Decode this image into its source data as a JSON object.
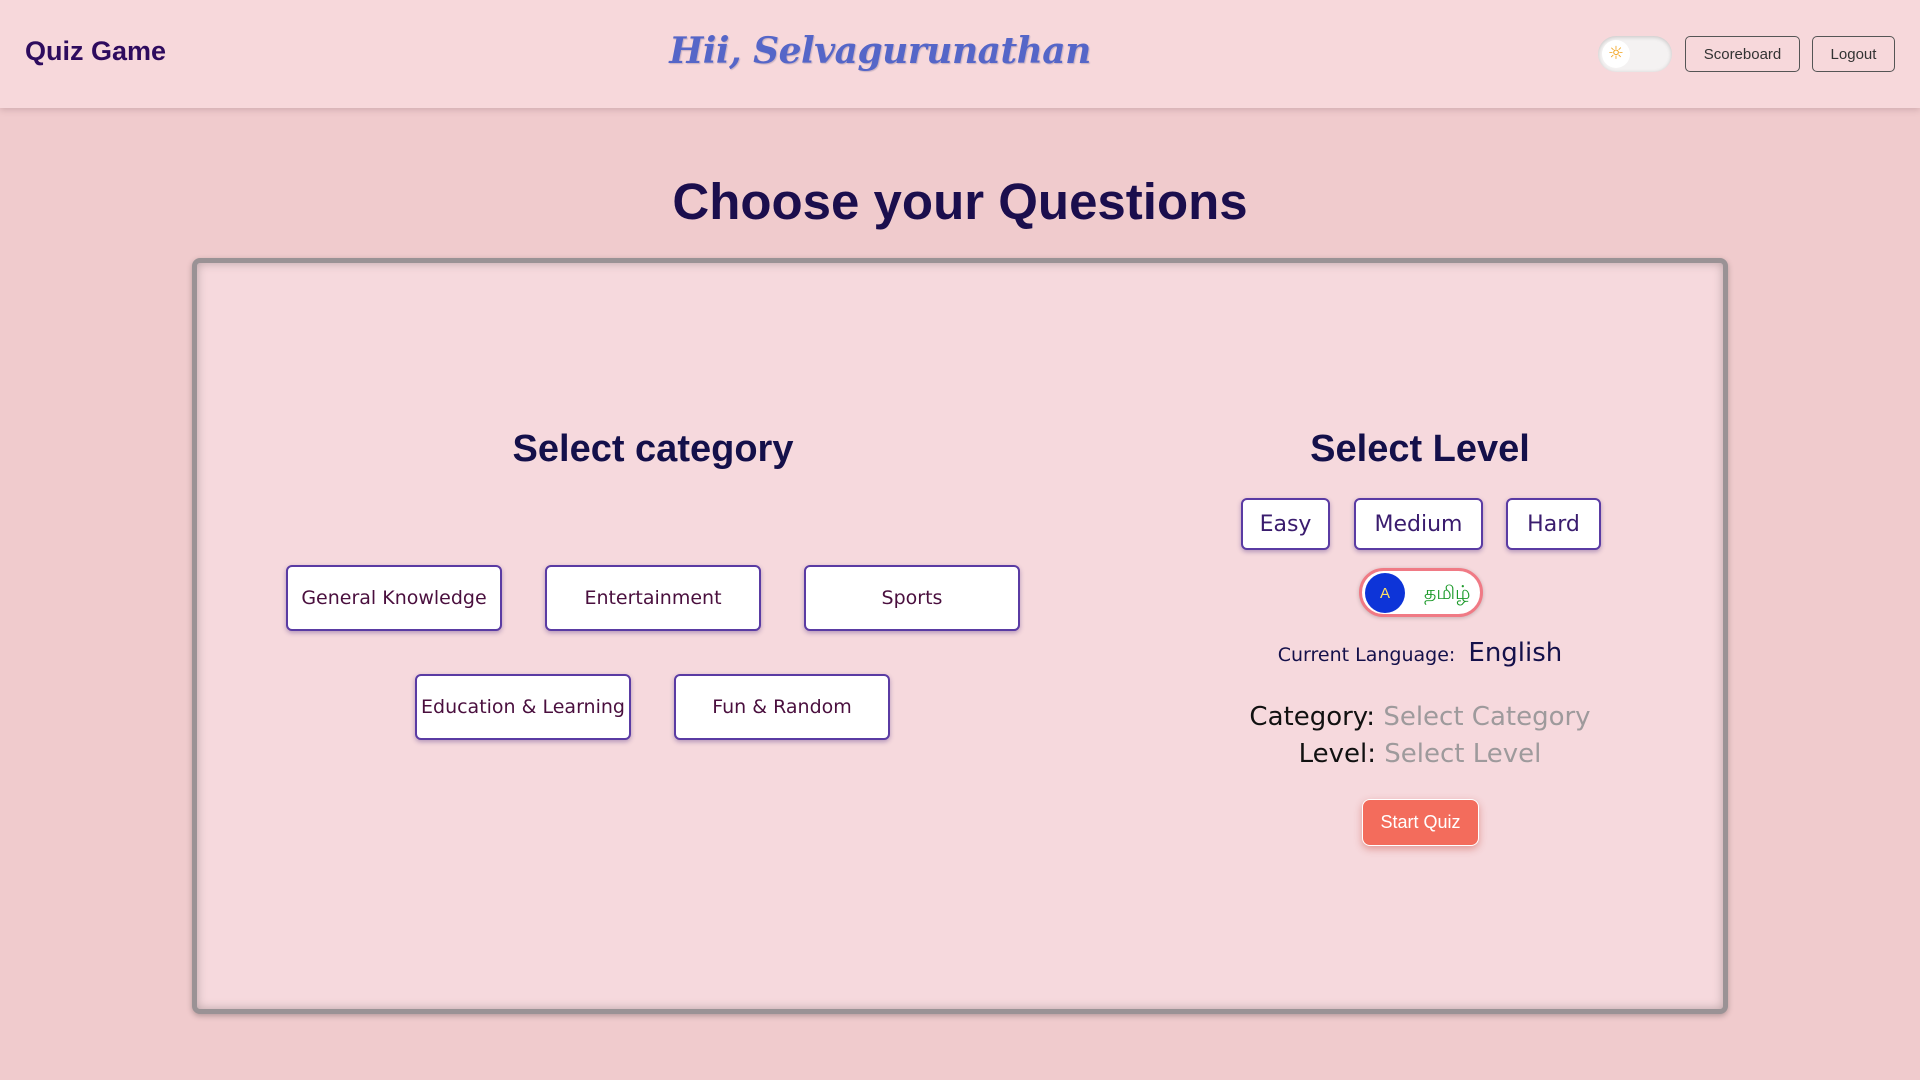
{
  "header": {
    "brand": "Quiz Game",
    "greeting": "Hii, Selvagurunathan",
    "theme_icon": "sun-icon",
    "scoreboard_label": "Scoreboard",
    "logout_label": "Logout"
  },
  "page_title": "Choose your Questions",
  "category": {
    "title": "Select category",
    "options": [
      "General Knowledge",
      "Entertainment",
      "Sports",
      "Education & Learning",
      "Fun & Random"
    ]
  },
  "level": {
    "title": "Select Level",
    "options": [
      "Easy",
      "Medium",
      "Hard"
    ]
  },
  "language_toggle": {
    "knob_label": "A",
    "alt_label": "தமிழ்"
  },
  "current_language": {
    "label": "Current Language:",
    "value": "English"
  },
  "selection": {
    "category_label": "Category:",
    "category_value": "Select Category",
    "level_label": "Level:",
    "level_value": "Select Level"
  },
  "start_label": "Start Quiz",
  "colors": {
    "background": "#f0cbcd",
    "header": "#f7d8db",
    "accent": "#f36c5c",
    "button_border": "#5a3ba3",
    "toggle_knob": "#0d34d8"
  }
}
